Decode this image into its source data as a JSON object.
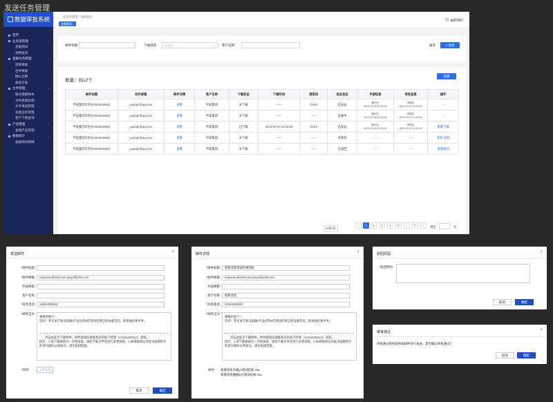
{
  "page_title": "发送任务管理",
  "app": {
    "logo_text": "数据审批系统",
    "breadcrumb": "业务单管理 / 金融测试",
    "active_tag": "金融测试 ×",
    "user": "admin"
  },
  "menu": [
    {
      "label": "首页",
      "level": 0
    },
    {
      "label": "业务单管理",
      "level": 0,
      "arrow": "⌄"
    },
    {
      "label": "金融测试",
      "level": 1
    },
    {
      "label": "调用查询",
      "level": 1
    },
    {
      "label": "金融任务管理",
      "level": 0,
      "arrow": "⌄"
    },
    {
      "label": "提取数据",
      "level": 1
    },
    {
      "label": "合并数据",
      "level": 1
    },
    {
      "label": "确认出网",
      "level": 1
    },
    {
      "label": "质检外发",
      "level": 1
    },
    {
      "label": "文件管理",
      "level": 0,
      "arrow": "⌄"
    },
    {
      "label": "联合建模样本",
      "level": 1
    },
    {
      "label": "文件质量处理",
      "level": 1
    },
    {
      "label": "文件发送管理",
      "level": 1
    },
    {
      "label": "发送任务管理",
      "level": 1
    },
    {
      "label": "客户下载查询",
      "level": 1
    },
    {
      "label": "产品管理",
      "level": 0,
      "arrow": "⌄"
    },
    {
      "label": "金融产品管理",
      "level": 1
    },
    {
      "label": "数据统计",
      "level": 0,
      "arrow": "⌄"
    },
    {
      "label": "金融测试明细",
      "level": 1
    }
  ],
  "search": {
    "mail_title_label": "邮件标题:",
    "download_status_label": "下载状态:",
    "download_status_placeholder": "请选择",
    "customer_name_label": "客户名称:",
    "collapse_label": "展开",
    "query_label": "查询"
  },
  "list": {
    "count_text": "数量：共12个",
    "new_button": "新建",
    "columns": [
      "邮件标题",
      "收件邮箱",
      "邮件详情",
      "客户名称",
      "下载状态",
      "下载时间",
      "提取码",
      "发送状态",
      "申请信息",
      "审批信息",
      "操作"
    ],
    "rows": [
      {
        "title": "平安集团车险分2023020901",
        "email": "yuduqh@qq.com",
        "detail": "查看",
        "customer": "平安集团",
        "dl_status": "未下载",
        "dl_time": "-----",
        "code": "GHUI",
        "send_status": "已发送",
        "apply": [
          "樊沢达",
          "2023-02-28 12:00:00"
        ],
        "approve": [
          "李轻生",
          "2023-03-01 12:00:00"
        ],
        "ops": "--"
      },
      {
        "title": "平安集团车险分2023020901",
        "email": "yuduqh@qq.com",
        "detail": "查看",
        "customer": "平安集团",
        "dl_status": "未下载",
        "dl_time": "-----",
        "code": "-----",
        "send_status": "压缩中",
        "apply": [
          "樊沢达",
          "2023-02-28 12:00:00"
        ],
        "approve": [
          "李轻生",
          "2023-03-01 12:00:00"
        ],
        "ops": "--"
      },
      {
        "title": "平安集团车险分2023020901",
        "email": "yuduqh@qq.com",
        "detail": "查看",
        "customer": "平安集团",
        "dl_status": "已下载",
        "dl_time": "2023-02-10 12:00:00",
        "code": "GHUI",
        "send_status": "已发送",
        "apply": [
          "樊沢达",
          "2023-02-28 12:00:00"
        ],
        "approve": [
          "李轻生",
          "2023-03-01 12:00:00"
        ],
        "ops": "重置下载"
      },
      {
        "title": "平安集团车险分2023020901",
        "email": "yuduqh@qq.com",
        "detail": "查看",
        "customer": "平安集团",
        "dl_status": "未下载",
        "dl_time": "-----",
        "code": "-----",
        "send_status": "待审批",
        "apply": [
          "-----"
        ],
        "approve": [
          "-----"
        ],
        "ops": "审批  驳回"
      },
      {
        "title": "平安集团车险分2023020901",
        "email": "yuduqh@qq.com",
        "detail": "查看",
        "customer": "平安集团",
        "dl_status": "未下载",
        "dl_time": "-----",
        "code": "-----",
        "send_status": "已驳回",
        "apply": [
          "-----"
        ],
        "approve": [
          "-----"
        ],
        "ops": "查看驳回"
      }
    ],
    "pagination": {
      "page_size": "20条/页",
      "pages": [
        "‹",
        "1",
        "2",
        "3",
        "4",
        "5",
        "...",
        "7",
        "›"
      ],
      "current": "1",
      "goto_label": "跳至",
      "goto_suffix": "页"
    }
  },
  "send_dialog": {
    "title": "发送邮件",
    "close": "×",
    "fields": [
      {
        "label": "*邮件标题:",
        "value": ""
      },
      {
        "label": "*收件邮箱:",
        "value": "ertyuiouu@163.com;yiuyui@163.com"
      },
      {
        "label": "抄送邮箱:",
        "value": ""
      },
      {
        "label": "客户名称:",
        "value": ""
      },
      {
        "label": "*商务电话:",
        "value": "13264283613"
      }
    ],
    "body_label": "*邮件正文:",
    "body_lines": [
      "尊敬的客户:",
      "    您好！贵司关于联洋国顺6产品名称6的测试结果已经准备完成，请查收结果文件。"
    ],
    "notice_lines": [
      "点击此处可下载附件，附件提取码请联系您的客户经理（13264283613）获取。",
      "提示：1.本下载链接为一次性链接，请您下载文件后进行妥善保管。2.本邮箱地址为联洋国顺用于外部沟通的公共账号，请勿直接回复。"
    ],
    "attach_label": "*附件:",
    "upload_label": "上传文件",
    "cancel": "取消",
    "ok": "确定"
  },
  "detail_dialog": {
    "title": "邮件详情",
    "close": "×",
    "fields": [
      {
        "label": "*邮件标题:",
        "value": "啥德消金测试结果回执"
      },
      {
        "label": "*收件邮箱:",
        "value": "ertyuiouu@163.com;yiuyui@163.com"
      },
      {
        "label": "抄送邮箱:",
        "value": ""
      },
      {
        "label": "客户名称:",
        "value": "啥德消金"
      },
      {
        "label": "*商务电话:",
        "value": "13264283613"
      }
    ],
    "body_label": "*邮件正文:",
    "body_lines": [
      "尊敬的客户:",
      "    您好！贵司关于联洋国顺6产品名称6的测试结果已经准备完成，请查收结果文件。"
    ],
    "notice_lines": [
      "点击此处可下载附件，附件提取码请联系您的客户经理（13264283613）获取。",
      "提示：1.本下载链接为一次性链接，请您下载文件后进行妥善保管。2.本邮箱地址为联洋国顺用于外部沟通的公共账号，请勿直接回复。"
    ],
    "attach_label": "附件:",
    "files": [
      "啥德消金开箱yx测试结果.xlsx",
      "啥德消金醒醒B分测试结果.xlsx"
    ]
  },
  "reject_dialog": {
    "title": "驳回原因",
    "close": "×",
    "label": "*驳回原因:",
    "cancel": "取消",
    "ok": "确定"
  },
  "approve_dialog": {
    "title": "审批通过",
    "close": "×",
    "message": "审批通过系统会将本邮件进行发送，是否确认审批通过？",
    "cancel": "取消",
    "ok": "确定"
  }
}
